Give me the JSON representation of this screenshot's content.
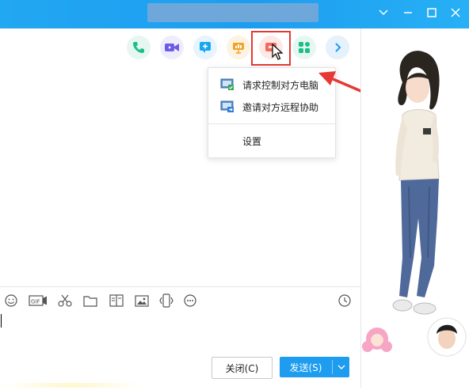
{
  "window": {
    "title_redacted": true,
    "controls": [
      "chevron-down-icon",
      "minimize-icon",
      "maximize-icon",
      "close-icon"
    ]
  },
  "toolbar": {
    "buttons": [
      {
        "name": "voice-call",
        "icon": "phone-icon",
        "color": "#1bbf8a"
      },
      {
        "name": "video-call",
        "icon": "video-icon",
        "color": "#6b5ce7"
      },
      {
        "name": "share-screen",
        "icon": "screen-plus-icon",
        "color": "#18a6f0"
      },
      {
        "name": "presentation",
        "icon": "presentation-icon",
        "color": "#f4a224"
      },
      {
        "name": "remote-control",
        "icon": "remote-desktop-icon",
        "color": "#f26b5b"
      },
      {
        "name": "apps",
        "icon": "apps-icon",
        "color": "#1bbf8a"
      },
      {
        "name": "more",
        "icon": "chevron-right-icon",
        "color": "#1d9cf0"
      }
    ]
  },
  "menu": {
    "items": [
      {
        "label": "请求控制对方电脑"
      },
      {
        "label": "邀请对方远程协助"
      }
    ],
    "settings": "设置"
  },
  "input_toolbar": {
    "icons": [
      "emoji-icon",
      "gif-icon",
      "scissors-icon",
      "folder-icon",
      "image-text-icon",
      "image-icon",
      "phone-shake-icon",
      "more-icon",
      "history-icon"
    ]
  },
  "actions": {
    "close": "关闭(C)",
    "send": "发送(S)"
  }
}
